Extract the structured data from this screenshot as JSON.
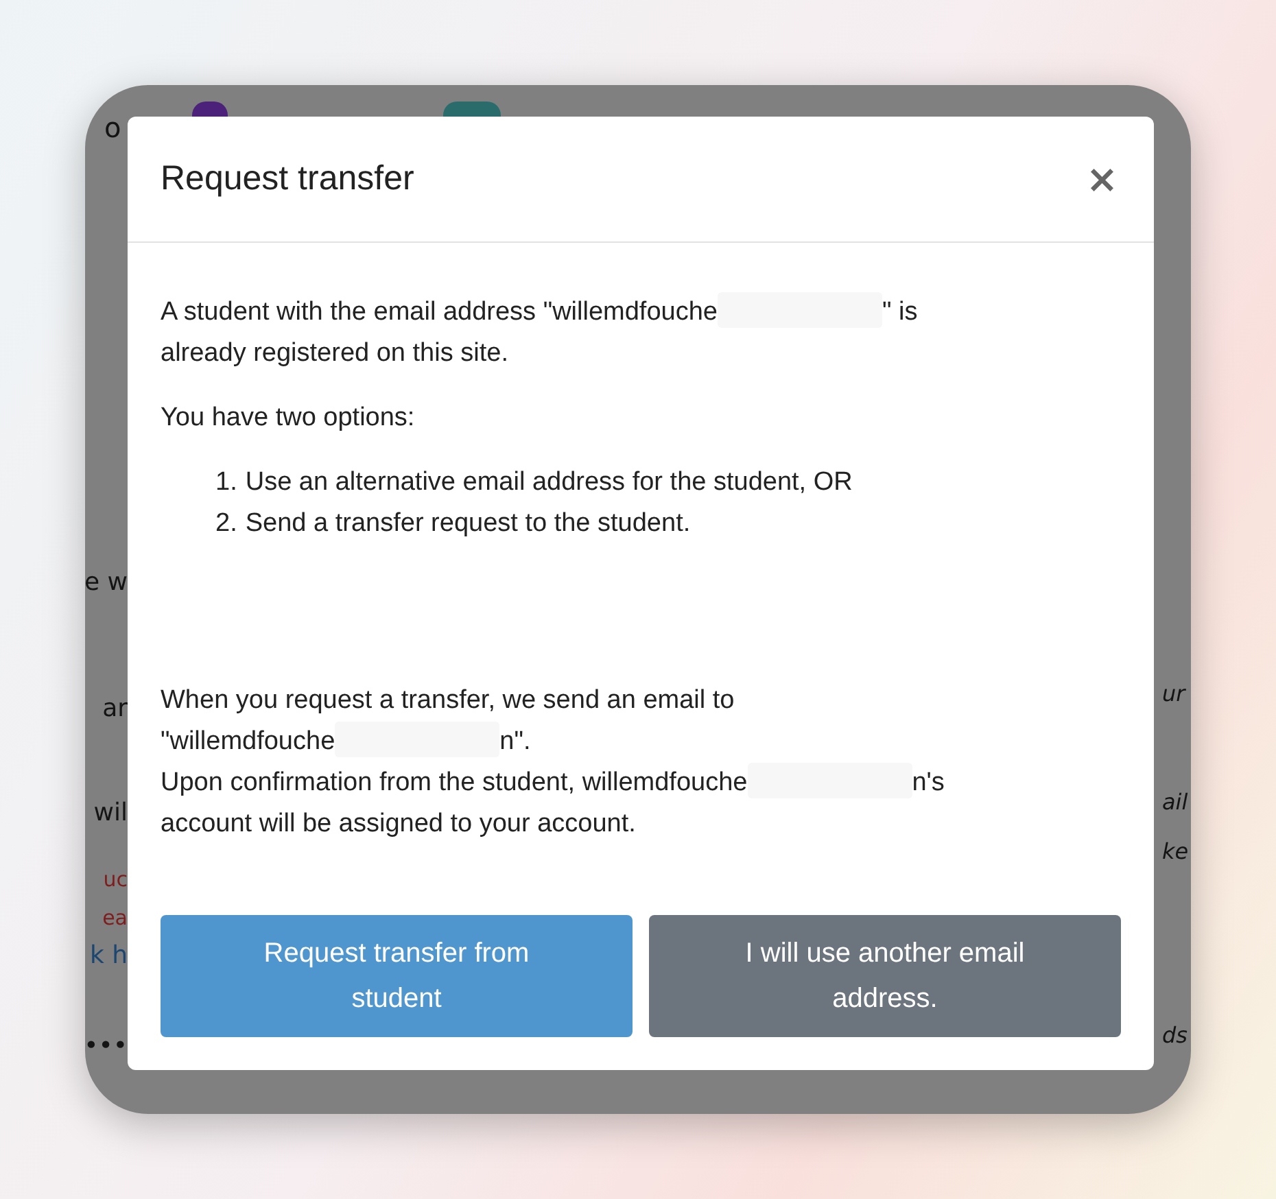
{
  "background": {
    "left_fragments": [
      {
        "text": "o",
        "kind": "plain"
      },
      {
        "text": "e w",
        "kind": "plain"
      },
      {
        "text": "ar",
        "kind": "plain"
      },
      {
        "text": "wil",
        "kind": "plain"
      },
      {
        "text": "uc",
        "kind": "error"
      },
      {
        "text": "ea",
        "kind": "error"
      },
      {
        "text": "k h",
        "kind": "link"
      },
      {
        "text": "•••",
        "kind": "plain"
      }
    ],
    "right_fragments": [
      {
        "text": "ur",
        "kind": "plain"
      },
      {
        "text": "ail",
        "kind": "plain"
      },
      {
        "text": "ke",
        "kind": "plain"
      },
      {
        "text": "ds",
        "kind": "plain"
      }
    ]
  },
  "dialog": {
    "title": "Request transfer",
    "close": "×",
    "intro": [
      [
        {
          "kind": "text",
          "text": "A student with the email address \"willemdfouche"
        },
        {
          "kind": "redaction"
        },
        {
          "kind": "text",
          "text": "\" is"
        }
      ],
      [
        {
          "kind": "text",
          "text": "already registered on this site."
        }
      ]
    ],
    "options_lead": "You have two options:",
    "options": [
      {
        "number": "1.",
        "text": "Use an alternative email address for the student, OR"
      },
      {
        "number": "2.",
        "text": "Send a transfer request to the student."
      }
    ],
    "explanation": [
      [
        {
          "kind": "text",
          "text": "When you request a transfer, we send an email to"
        }
      ],
      [
        {
          "kind": "text",
          "text": "\"willemdfouche"
        },
        {
          "kind": "redaction"
        },
        {
          "kind": "text",
          "text": "n\"."
        }
      ],
      [
        {
          "kind": "text",
          "text": "Upon confirmation from the student, willemdfouche"
        },
        {
          "kind": "redaction"
        },
        {
          "kind": "text",
          "text": "n's"
        }
      ],
      [
        {
          "kind": "text",
          "text": "account will be assigned to your account."
        }
      ]
    ],
    "buttons": [
      {
        "label": "Request transfer from student",
        "kind": "primary"
      },
      {
        "label": "I will use another email address.",
        "kind": "secondary"
      }
    ]
  }
}
